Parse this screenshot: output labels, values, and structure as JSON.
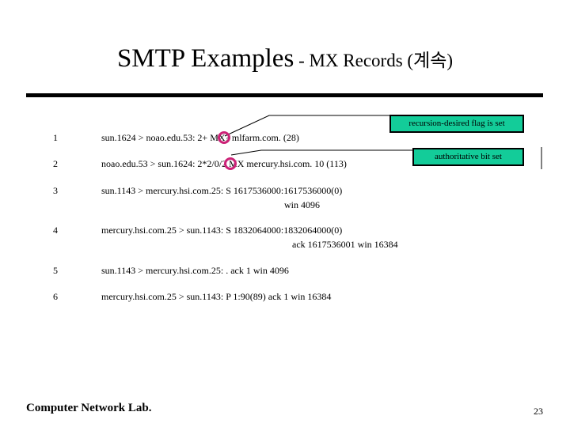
{
  "slide": {
    "title_main": "SMTP Examples",
    "title_sub": " - MX Records (계속)",
    "accent_teal": "#13cc99",
    "accent_ring": "#cc2277",
    "rule_color": "#000000"
  },
  "trace": {
    "rows": [
      {
        "num": "1",
        "text_before": "sun.1624 > noao.edu.53: 2",
        "marked": "+",
        "text_after": " MX? mlfarm.com. (28)",
        "full": "sun.1624 > noao.edu.53: 2+ MX? mlfarm.com. (28)",
        "continuation": ""
      },
      {
        "num": "2",
        "text_before": "noao.edu.53 > sun.1624: 2",
        "marked": "*",
        "text_after": "2/0/2 MX mercury.hsi.com. 10 (113)",
        "full": "noao.edu.53 > sun.1624: 2*2/0/2 MX mercury.hsi.com. 10 (113)",
        "continuation": ""
      },
      {
        "num": "3",
        "text_before": "",
        "marked": "",
        "text_after": "",
        "full": "sun.1143 > mercury.hsi.com.25: S 1617536000:1617536000(0)",
        "continuation": "win 4096"
      },
      {
        "num": "4",
        "text_before": "",
        "marked": "",
        "text_after": "",
        "full": "mercury.hsi.com.25 > sun.1143: S 1832064000:1832064000(0)",
        "continuation": "ack 1617536001 win 16384"
      },
      {
        "num": "5",
        "text_before": "",
        "marked": "",
        "text_after": "",
        "full": "sun.1143 > mercury.hsi.com.25: . ack 1 win 4096",
        "continuation": ""
      },
      {
        "num": "6",
        "text_before": "",
        "marked": "",
        "text_after": "",
        "full": "mercury.hsi.com.25 > sun.1143: P 1:90(89) ack 1 win 16384",
        "continuation": ""
      }
    ]
  },
  "callouts": {
    "recursion": "recursion-desired flag is set",
    "authoritative": "authoritative bit set"
  },
  "footer": {
    "label": "Computer Network Lab.",
    "page": "23"
  }
}
